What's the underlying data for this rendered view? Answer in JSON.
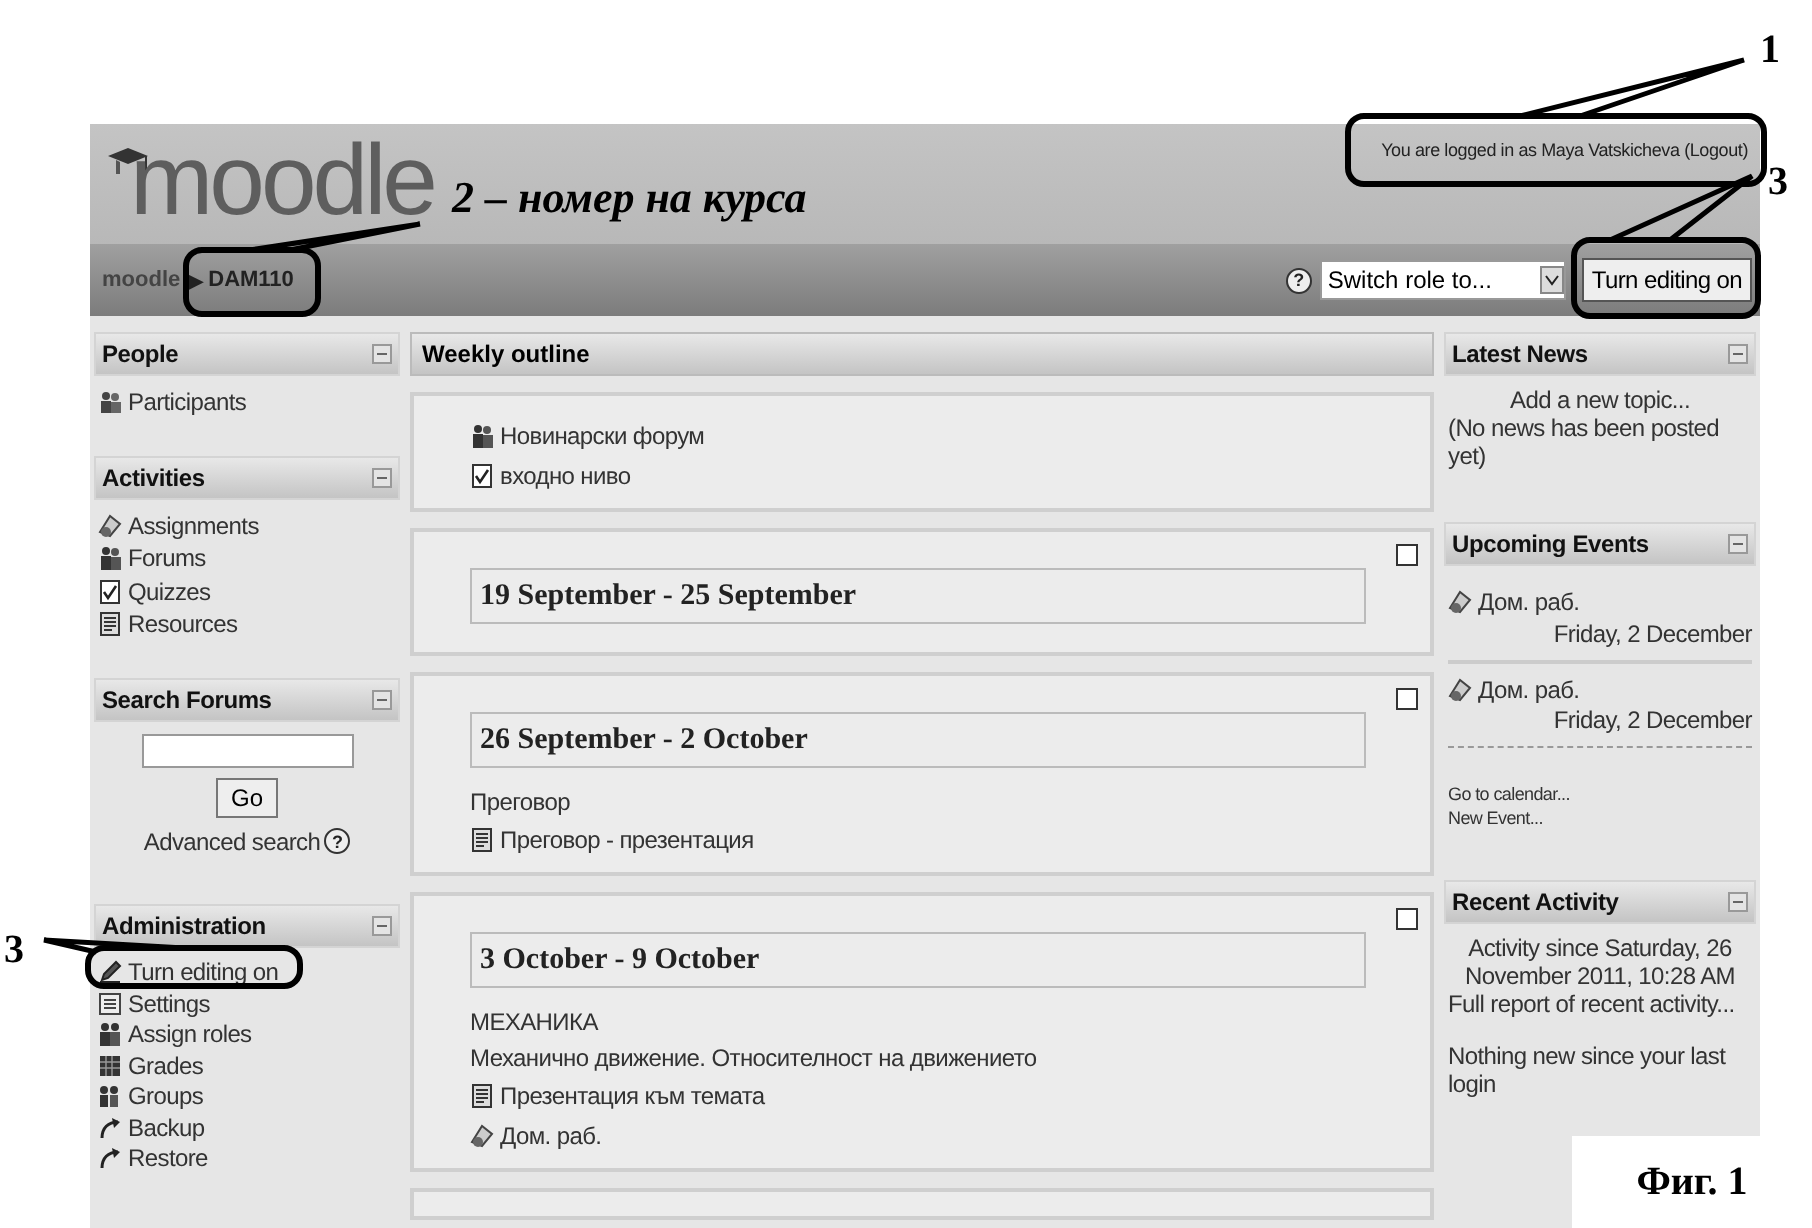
{
  "header": {
    "logo": "moodle",
    "login_text": "You are logged in as Maya Vatskicheva (Logout)"
  },
  "navbar": {
    "breadcrumb": [
      {
        "label": "moodle"
      },
      {
        "label": "DAM110"
      }
    ],
    "separator": "▶",
    "help": "?",
    "role_select": {
      "value": "Switch role to..."
    },
    "edit_button": "Turn editing on"
  },
  "left_blocks": [
    {
      "kind": "list",
      "title": "People",
      "items": [
        {
          "kind": "participants",
          "label": "Participants"
        }
      ]
    },
    {
      "kind": "list",
      "title": "Activities",
      "items": [
        {
          "kind": "assignment",
          "label": "Assignments"
        },
        {
          "kind": "forum",
          "label": "Forums"
        },
        {
          "kind": "quiz",
          "label": "Quizzes"
        },
        {
          "kind": "resource",
          "label": "Resources"
        }
      ]
    },
    {
      "kind": "search",
      "title": "Search Forums",
      "button": "Go",
      "link": "Advanced search",
      "help": "?"
    },
    {
      "kind": "list",
      "title": "Administration",
      "items": [
        {
          "kind": "edit",
          "label": "Turn editing on"
        },
        {
          "kind": "settings",
          "label": "Settings"
        },
        {
          "kind": "roles",
          "label": "Assign roles"
        },
        {
          "kind": "grades",
          "label": "Grades"
        },
        {
          "kind": "groups",
          "label": "Groups"
        },
        {
          "kind": "backup",
          "label": "Backup"
        },
        {
          "kind": "restore",
          "label": "Restore"
        }
      ]
    }
  ],
  "outline": {
    "title": "Weekly outline",
    "sections": [
      {
        "items": [
          {
            "kind": "forum",
            "label": "Новинарски форум"
          },
          {
            "kind": "quiz",
            "label": "входно ниво"
          }
        ]
      },
      {
        "title": "19 September - 25 September",
        "highlighted": false
      },
      {
        "title": "26 September - 2 October",
        "highlighted": false,
        "summary": [
          "Преговор"
        ],
        "items": [
          {
            "kind": "resource",
            "label": "Преговор - презентация"
          }
        ]
      },
      {
        "title": "3 October - 9 October",
        "highlighted": false,
        "summary": [
          "МЕХАНИКА",
          "Механично движение. Относителност на движението"
        ],
        "items": [
          {
            "kind": "resource",
            "label": "Презентация към темата"
          },
          {
            "kind": "assignment",
            "label": "Дом. раб."
          }
        ]
      }
    ]
  },
  "right_blocks": [
    {
      "kind": "news",
      "title": "Latest News",
      "link": "Add a new topic...",
      "text": "(No news has been posted yet)"
    },
    {
      "kind": "events",
      "title": "Upcoming Events",
      "events": [
        {
          "label": "Дом. раб.",
          "date": "Friday, 2 December"
        },
        {
          "label": "Дом. раб.",
          "date": "Friday, 2 December"
        }
      ],
      "links": [
        "Go to calendar...",
        "New Event..."
      ]
    },
    {
      "kind": "activity",
      "title": "Recent Activity",
      "since": "Activity since Saturday, 26 November 2011, 10:28 AM",
      "link": "Full report of recent activity...",
      "text": "Nothing new since your last login"
    }
  ],
  "annotations": [
    {
      "label": "1"
    },
    {
      "label": "2 – номер на курса"
    },
    {
      "label": "3"
    },
    {
      "label": "3"
    }
  ],
  "caption": "Фиг. 1"
}
